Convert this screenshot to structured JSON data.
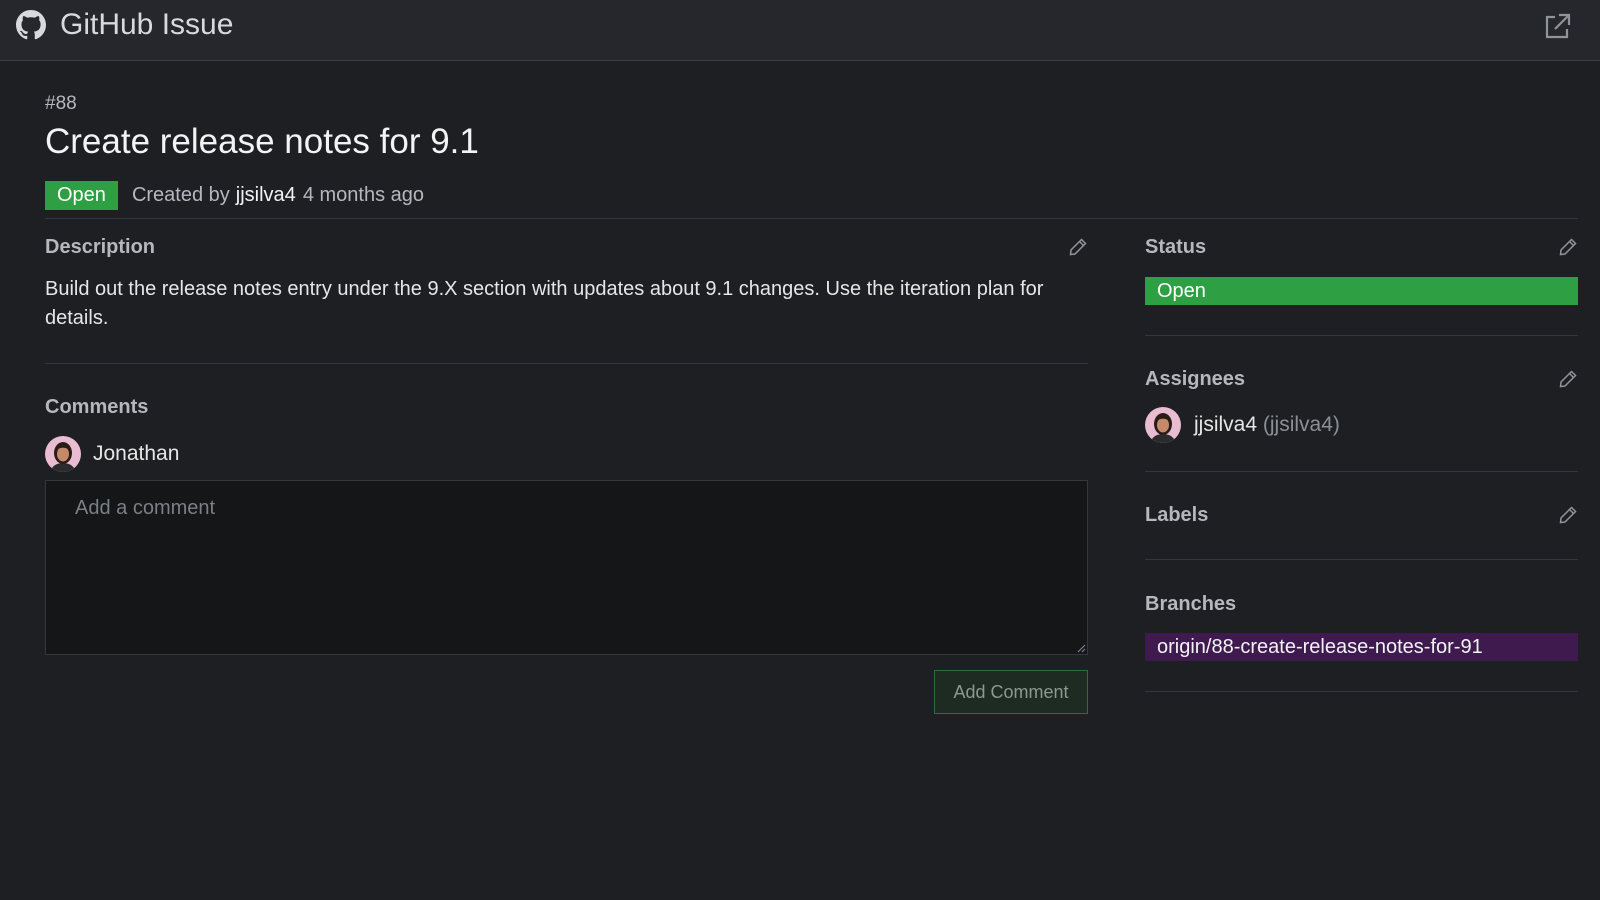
{
  "app": {
    "title": "GitHub Issue"
  },
  "issue": {
    "number": "#88",
    "title": "Create release notes for 9.1",
    "state": "Open",
    "created_prefix": "Created by",
    "author": "jjsilva4",
    "created_ago": "4 months ago"
  },
  "description": {
    "heading": "Description",
    "body": "Build out the release notes entry under the 9.X section with updates about 9.1 changes. Use the iteration plan for details."
  },
  "comments": {
    "heading": "Comments",
    "current_user": "Jonathan",
    "input_placeholder": "Add a comment",
    "input_value": "",
    "submit_label": "Add Comment"
  },
  "sidebar": {
    "status": {
      "heading": "Status",
      "value": "Open"
    },
    "assignees": {
      "heading": "Assignees",
      "items": [
        {
          "name": "jjsilva4",
          "login": "(jjsilva4)"
        }
      ]
    },
    "labels": {
      "heading": "Labels"
    },
    "branches": {
      "heading": "Branches",
      "items": [
        "origin/88-create-release-notes-for-91"
      ]
    }
  },
  "colors": {
    "background": "#1e1f22",
    "titlebar": "#25272c",
    "open_green": "#2ea043",
    "branch_purple": "#3e1a4e"
  },
  "icons": {
    "app": "github-icon",
    "open_external": "external-link-icon",
    "edit": "pencil-icon"
  }
}
